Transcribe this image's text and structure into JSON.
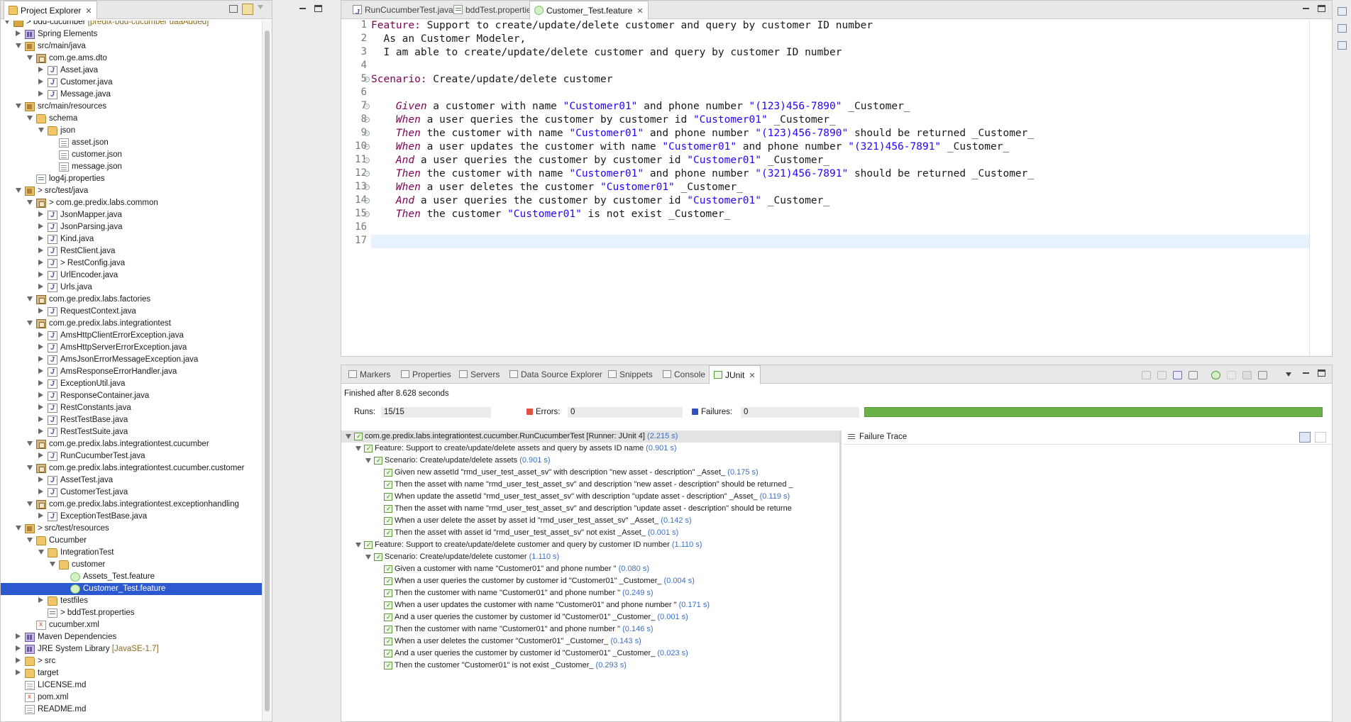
{
  "explorer": {
    "title": "Project Explorer",
    "tree": [
      {
        "depth": 0,
        "open": true,
        "icon": "project",
        "label": "bdd-cucumber",
        "deco": " [predix-bdd-cucumber uaaAdded]",
        "prefix": "> "
      },
      {
        "depth": 1,
        "open": false,
        "icon": "lib",
        "label": "Spring Elements"
      },
      {
        "depth": 1,
        "open": true,
        "icon": "srcfolder",
        "label": "src/main/java"
      },
      {
        "depth": 2,
        "open": true,
        "icon": "package",
        "label": "com.ge.ams.dto"
      },
      {
        "depth": 3,
        "open": false,
        "icon": "java",
        "label": "Asset.java"
      },
      {
        "depth": 3,
        "open": false,
        "icon": "java",
        "label": "Customer.java"
      },
      {
        "depth": 3,
        "open": false,
        "icon": "java",
        "label": "Message.java"
      },
      {
        "depth": 1,
        "open": true,
        "icon": "srcfolder",
        "label": "src/main/resources"
      },
      {
        "depth": 2,
        "open": true,
        "icon": "folder",
        "label": "schema"
      },
      {
        "depth": 3,
        "open": true,
        "icon": "folder",
        "label": "json"
      },
      {
        "depth": 4,
        "open": null,
        "icon": "file",
        "label": "asset.json"
      },
      {
        "depth": 4,
        "open": null,
        "icon": "file",
        "label": "customer.json"
      },
      {
        "depth": 4,
        "open": null,
        "icon": "file",
        "label": "message.json"
      },
      {
        "depth": 2,
        "open": null,
        "icon": "props",
        "label": "log4j.properties"
      },
      {
        "depth": 1,
        "open": true,
        "icon": "srcfolder",
        "label": "src/test/java",
        "prefix": "> "
      },
      {
        "depth": 2,
        "open": true,
        "icon": "package",
        "label": "com.ge.predix.labs.common",
        "prefix": "> "
      },
      {
        "depth": 3,
        "open": false,
        "icon": "java",
        "label": "JsonMapper.java"
      },
      {
        "depth": 3,
        "open": false,
        "icon": "java",
        "label": "JsonParsing.java"
      },
      {
        "depth": 3,
        "open": false,
        "icon": "java",
        "label": "Kind.java"
      },
      {
        "depth": 3,
        "open": false,
        "icon": "java",
        "label": "RestClient.java"
      },
      {
        "depth": 3,
        "open": false,
        "icon": "java",
        "label": "RestConfig.java",
        "prefix": "> "
      },
      {
        "depth": 3,
        "open": false,
        "icon": "java",
        "label": "UrlEncoder.java"
      },
      {
        "depth": 3,
        "open": false,
        "icon": "java",
        "label": "Urls.java"
      },
      {
        "depth": 2,
        "open": true,
        "icon": "package",
        "label": "com.ge.predix.labs.factories"
      },
      {
        "depth": 3,
        "open": false,
        "icon": "java",
        "label": "RequestContext.java"
      },
      {
        "depth": 2,
        "open": true,
        "icon": "package",
        "label": "com.ge.predix.labs.integrationtest"
      },
      {
        "depth": 3,
        "open": false,
        "icon": "java",
        "label": "AmsHttpClientErrorException.java"
      },
      {
        "depth": 3,
        "open": false,
        "icon": "java",
        "label": "AmsHttpServerErrorException.java"
      },
      {
        "depth": 3,
        "open": false,
        "icon": "java",
        "label": "AmsJsonErrorMessageException.java"
      },
      {
        "depth": 3,
        "open": false,
        "icon": "java",
        "label": "AmsResponseErrorHandler.java"
      },
      {
        "depth": 3,
        "open": false,
        "icon": "java",
        "label": "ExceptionUtil.java"
      },
      {
        "depth": 3,
        "open": false,
        "icon": "java",
        "label": "ResponseContainer.java"
      },
      {
        "depth": 3,
        "open": false,
        "icon": "java",
        "label": "RestConstants.java"
      },
      {
        "depth": 3,
        "open": false,
        "icon": "java",
        "label": "RestTestBase.java"
      },
      {
        "depth": 3,
        "open": false,
        "icon": "java",
        "label": "RestTestSuite.java"
      },
      {
        "depth": 2,
        "open": true,
        "icon": "package",
        "label": "com.ge.predix.labs.integrationtest.cucumber"
      },
      {
        "depth": 3,
        "open": false,
        "icon": "java",
        "label": "RunCucumberTest.java"
      },
      {
        "depth": 2,
        "open": true,
        "icon": "package",
        "label": "com.ge.predix.labs.integrationtest.cucumber.customer"
      },
      {
        "depth": 3,
        "open": false,
        "icon": "java",
        "label": "AssetTest.java"
      },
      {
        "depth": 3,
        "open": false,
        "icon": "java",
        "label": "CustomerTest.java"
      },
      {
        "depth": 2,
        "open": true,
        "icon": "package",
        "label": "com.ge.predix.labs.integrationtest.exceptionhandling"
      },
      {
        "depth": 3,
        "open": false,
        "icon": "java",
        "label": "ExceptionTestBase.java"
      },
      {
        "depth": 1,
        "open": true,
        "icon": "srcfolder",
        "label": "src/test/resources",
        "prefix": "> "
      },
      {
        "depth": 2,
        "open": true,
        "icon": "folder",
        "label": "Cucumber"
      },
      {
        "depth": 3,
        "open": true,
        "icon": "folder",
        "label": "IntegrationTest"
      },
      {
        "depth": 4,
        "open": true,
        "icon": "folder",
        "label": "customer"
      },
      {
        "depth": 5,
        "open": null,
        "icon": "cuke",
        "label": "Assets_Test.feature"
      },
      {
        "depth": 5,
        "open": null,
        "icon": "cuke",
        "label": "Customer_Test.feature",
        "selected": true
      },
      {
        "depth": 3,
        "open": false,
        "icon": "folder",
        "label": "testfiles"
      },
      {
        "depth": 3,
        "open": null,
        "icon": "props",
        "label": "bddTest.properties",
        "prefix": "> "
      },
      {
        "depth": 2,
        "open": null,
        "icon": "xml",
        "label": "cucumber.xml"
      },
      {
        "depth": 1,
        "open": false,
        "icon": "lib",
        "label": "Maven Dependencies"
      },
      {
        "depth": 1,
        "open": false,
        "icon": "lib",
        "label": "JRE System Library",
        "deco": " [JavaSE-1.7]"
      },
      {
        "depth": 1,
        "open": false,
        "icon": "folder",
        "label": "src",
        "prefix": "> "
      },
      {
        "depth": 1,
        "open": false,
        "icon": "folder",
        "label": "target"
      },
      {
        "depth": 1,
        "open": null,
        "icon": "md",
        "label": "LICENSE.md"
      },
      {
        "depth": 1,
        "open": null,
        "icon": "xml",
        "label": "pom.xml"
      },
      {
        "depth": 1,
        "open": null,
        "icon": "md",
        "label": "README.md"
      }
    ]
  },
  "editor": {
    "tabs": [
      {
        "label": "RunCucumberTest.java",
        "icon": "java"
      },
      {
        "label": "bddTest.properties",
        "icon": "props"
      },
      {
        "label": "Customer_Test.feature",
        "icon": "cuke",
        "active": true
      }
    ],
    "lines": [
      {
        "n": "1",
        "fold": false,
        "parts": [
          [
            "kw",
            "Feature:"
          ],
          [
            "ws",
            " Support to create/update/delete customer and query by customer ID number"
          ]
        ]
      },
      {
        "n": "2",
        "fold": false,
        "parts": [
          [
            "ws",
            "  As an Customer Modeler,"
          ]
        ]
      },
      {
        "n": "3",
        "fold": false,
        "parts": [
          [
            "ws",
            "  I am able to create/update/delete customer and query by customer ID number"
          ]
        ]
      },
      {
        "n": "4",
        "fold": false,
        "parts": []
      },
      {
        "n": "5",
        "fold": true,
        "parts": [
          [
            "kw",
            "Scenario:"
          ],
          [
            "ws",
            " Create/update/delete customer"
          ]
        ]
      },
      {
        "n": "6",
        "fold": false,
        "parts": []
      },
      {
        "n": "7",
        "fold": true,
        "parts": [
          [
            "ws",
            "    "
          ],
          [
            "kwi",
            "Given"
          ],
          [
            "ws",
            " a customer with name "
          ],
          [
            "str",
            "\"Customer01\""
          ],
          [
            "ws",
            " and phone number "
          ],
          [
            "str",
            "\"(123)456-7890\""
          ],
          [
            "ws",
            " _Customer_"
          ]
        ]
      },
      {
        "n": "8",
        "fold": true,
        "parts": [
          [
            "ws",
            "    "
          ],
          [
            "kwi",
            "When"
          ],
          [
            "ws",
            " a user queries the customer by customer id "
          ],
          [
            "str",
            "\"Customer01\""
          ],
          [
            "ws",
            " _Customer_"
          ]
        ]
      },
      {
        "n": "9",
        "fold": true,
        "parts": [
          [
            "ws",
            "    "
          ],
          [
            "kwi",
            "Then"
          ],
          [
            "ws",
            " the customer with name "
          ],
          [
            "str",
            "\"Customer01\""
          ],
          [
            "ws",
            " and phone number "
          ],
          [
            "str",
            "\"(123)456-7890\""
          ],
          [
            "ws",
            " should be returned _Customer_"
          ]
        ]
      },
      {
        "n": "10",
        "fold": true,
        "parts": [
          [
            "ws",
            "    "
          ],
          [
            "kwi",
            "When"
          ],
          [
            "ws",
            " a user updates the customer with name "
          ],
          [
            "str",
            "\"Customer01\""
          ],
          [
            "ws",
            " and phone number "
          ],
          [
            "str",
            "\"(321)456-7891\""
          ],
          [
            "ws",
            " _Customer_"
          ]
        ]
      },
      {
        "n": "11",
        "fold": true,
        "parts": [
          [
            "ws",
            "    "
          ],
          [
            "kwi",
            "And"
          ],
          [
            "ws",
            " a user queries the customer by customer id "
          ],
          [
            "str",
            "\"Customer01\""
          ],
          [
            "ws",
            " _Customer_"
          ]
        ]
      },
      {
        "n": "12",
        "fold": true,
        "parts": [
          [
            "ws",
            "    "
          ],
          [
            "kwi",
            "Then"
          ],
          [
            "ws",
            " the customer with name "
          ],
          [
            "str",
            "\"Customer01\""
          ],
          [
            "ws",
            " and phone number "
          ],
          [
            "str",
            "\"(321)456-7891\""
          ],
          [
            "ws",
            " should be returned _Customer_"
          ]
        ]
      },
      {
        "n": "13",
        "fold": true,
        "parts": [
          [
            "ws",
            "    "
          ],
          [
            "kwi",
            "When"
          ],
          [
            "ws",
            " a user deletes the customer "
          ],
          [
            "str",
            "\"Customer01\""
          ],
          [
            "ws",
            " _Customer_"
          ]
        ]
      },
      {
        "n": "14",
        "fold": true,
        "parts": [
          [
            "ws",
            "    "
          ],
          [
            "kwi",
            "And"
          ],
          [
            "ws",
            " a user queries the customer by customer id "
          ],
          [
            "str",
            "\"Customer01\""
          ],
          [
            "ws",
            " _Customer_"
          ]
        ]
      },
      {
        "n": "15",
        "fold": true,
        "parts": [
          [
            "ws",
            "    "
          ],
          [
            "kwi",
            "Then"
          ],
          [
            "ws",
            " the customer "
          ],
          [
            "str",
            "\"Customer01\""
          ],
          [
            "ws",
            " is not exist _Customer_"
          ]
        ]
      },
      {
        "n": "16",
        "fold": false,
        "parts": []
      },
      {
        "n": "17",
        "fold": false,
        "parts": [],
        "current": true
      }
    ]
  },
  "views": {
    "tabs": [
      {
        "label": "Markers"
      },
      {
        "label": "Properties"
      },
      {
        "label": "Servers"
      },
      {
        "label": "Data Source Explorer"
      },
      {
        "label": "Snippets"
      },
      {
        "label": "Console"
      },
      {
        "label": "JUnit",
        "active": true
      }
    ]
  },
  "junit": {
    "finished": "Finished after 8.628 seconds",
    "runs_label": "Runs:",
    "runs_value": "15/15",
    "errors_label": "Errors:",
    "errors_value": "0",
    "failures_label": "Failures:",
    "failures_value": "0",
    "progress": 1.0,
    "status_color": "#6aaf48",
    "failure_trace_label": "Failure Trace",
    "tree": [
      {
        "depth": 0,
        "open": true,
        "text": "com.ge.predix.labs.integrationtest.cucumber.RunCucumberTest [Runner: JUnit 4]",
        "time": " (2.215 s)",
        "header": true
      },
      {
        "depth": 1,
        "open": true,
        "text": "Feature: Support to create/update/delete assets and query by assets ID name",
        "time": " (0.901 s)"
      },
      {
        "depth": 2,
        "open": true,
        "text": "Scenario: Create/update/delete assets",
        "time": " (0.901 s)"
      },
      {
        "depth": 3,
        "open": null,
        "text": "Given new assetId \"rmd_user_test_asset_sv\" with description \"new asset - description\" _Asset_",
        "time": " (0.175 s)"
      },
      {
        "depth": 3,
        "open": null,
        "text": "Then the asset with name \"rmd_user_test_asset_sv\" and description \"new asset - description\" should be returned _",
        "time": ""
      },
      {
        "depth": 3,
        "open": null,
        "text": "When update the assetId \"rmd_user_test_asset_sv\" with description \"update asset - description\" _Asset_",
        "time": " (0.119 s)"
      },
      {
        "depth": 3,
        "open": null,
        "text": "Then the asset with name \"rmd_user_test_asset_sv\" and description \"update asset - description\" should be returne",
        "time": ""
      },
      {
        "depth": 3,
        "open": null,
        "text": "When a user delete the asset by asset id \"rmd_user_test_asset_sv\" _Asset_",
        "time": " (0.142 s)"
      },
      {
        "depth": 3,
        "open": null,
        "text": "Then the asset with asset id \"rmd_user_test_asset_sv\" not exist _Asset_",
        "time": " (0.001 s)"
      },
      {
        "depth": 1,
        "open": true,
        "text": "Feature: Support to create/update/delete customer and query by customer ID number",
        "time": " (1.110 s)"
      },
      {
        "depth": 2,
        "open": true,
        "text": "Scenario: Create/update/delete customer",
        "time": " (1.110 s)"
      },
      {
        "depth": 3,
        "open": null,
        "text": "Given a customer with name \"Customer01\" and phone number \"",
        "time": " (0.080 s)"
      },
      {
        "depth": 3,
        "open": null,
        "text": "When a user queries the customer by customer id \"Customer01\" _Customer_",
        "time": " (0.004 s)"
      },
      {
        "depth": 3,
        "open": null,
        "text": "Then the customer with name \"Customer01\" and phone number \"",
        "time": " (0.249 s)"
      },
      {
        "depth": 3,
        "open": null,
        "text": "When a user updates the customer with name \"Customer01\" and phone number \"",
        "time": " (0.171 s)"
      },
      {
        "depth": 3,
        "open": null,
        "text": "And a user queries the customer by customer id \"Customer01\" _Customer_",
        "time": " (0.001 s)"
      },
      {
        "depth": 3,
        "open": null,
        "text": "Then the customer with name \"Customer01\" and phone number \"",
        "time": " (0.146 s)"
      },
      {
        "depth": 3,
        "open": null,
        "text": "When a user deletes the customer \"Customer01\" _Customer_",
        "time": " (0.143 s)"
      },
      {
        "depth": 3,
        "open": null,
        "text": "And a user queries the customer by customer id \"Customer01\" _Customer_",
        "time": " (0.023 s)"
      },
      {
        "depth": 3,
        "open": null,
        "text": "Then the customer \"Customer01\" is not exist _Customer_",
        "time": " (0.293 s)"
      }
    ]
  }
}
